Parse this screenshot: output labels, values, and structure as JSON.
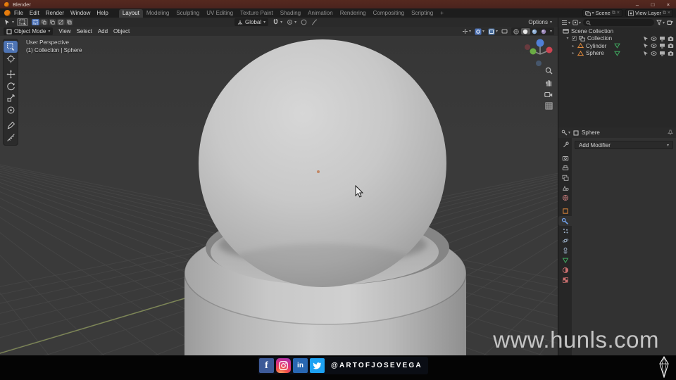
{
  "window": {
    "title": "Blender",
    "minimize": "–",
    "maximize": "□",
    "close": "×"
  },
  "menubar": {
    "menus": [
      "File",
      "Edit",
      "Render",
      "Window",
      "Help"
    ]
  },
  "workspaces": {
    "tabs": [
      "Layout",
      "Modeling",
      "Sculpting",
      "UV Editing",
      "Texture Paint",
      "Shading",
      "Animation",
      "Rendering",
      "Compositing",
      "Scripting"
    ],
    "add_tab": "+",
    "active": "Layout"
  },
  "scene_selector": {
    "scene": "Scene",
    "view_layer": "View Layer",
    "unlink": "×"
  },
  "tool_settings": {
    "orientation": "Global",
    "options": "Options",
    "options_caret": "▾"
  },
  "viewport": {
    "header": {
      "mode": "Object Mode",
      "menus": [
        "View",
        "Select",
        "Add",
        "Object"
      ]
    },
    "overlay": {
      "line1": "User Perspective",
      "line2": "(1) Collection | Sphere"
    }
  },
  "outliner": {
    "root": "Scene Collection",
    "items": [
      {
        "name": "Collection",
        "type": "collection"
      },
      {
        "name": "Cylinder",
        "type": "mesh"
      },
      {
        "name": "Sphere",
        "type": "mesh"
      }
    ]
  },
  "properties": {
    "breadcrumb": "Sphere",
    "add_modifier": "Add Modifier",
    "add_modifier_caret": "▾",
    "tabs": [
      "tool",
      "render",
      "output",
      "view-layer",
      "scene",
      "world",
      "object",
      "modifiers",
      "particles",
      "physics",
      "constraints",
      "object-data",
      "material",
      "texture"
    ],
    "active_tab": "modifiers"
  },
  "footer": {
    "handle": "@ARTOFJOSEVEGA",
    "icons": [
      "facebook",
      "instagram",
      "linkedin",
      "twitter"
    ]
  },
  "watermark": {
    "text": "www.hunls.com"
  },
  "glyphs": {
    "caret_down": "▾",
    "disc_open": "▾",
    "disc_closed": "▸",
    "check": "✓"
  },
  "colors": {
    "titlebar_red": "#4e2620",
    "accent_blue": "#4f74b8",
    "object_orange": "#e08a3c",
    "data_green": "#3fa85f",
    "viewport_bg": "#3a3a3a",
    "facebook": "#3d5a98",
    "instagram": "#d92e7f",
    "linkedin": "#2867b2",
    "twitter": "#1da1f2"
  }
}
